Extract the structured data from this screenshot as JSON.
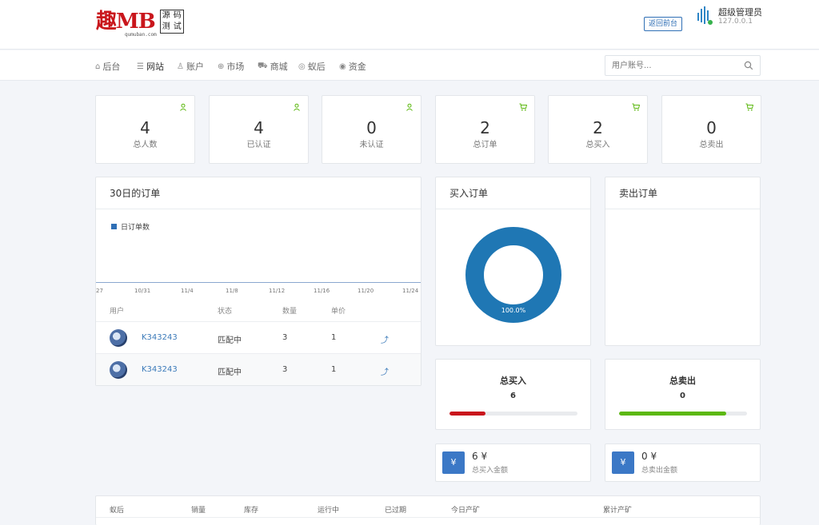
{
  "header": {
    "logo_main": "趣MB",
    "logo_sub": "qumuban.com",
    "logo_box": [
      "源",
      "码",
      "测",
      "试"
    ],
    "back_label": "返回前台",
    "admin_name": "超级管理员",
    "admin_ip": "127.0.0.1",
    "colors": {
      "logo": "#c9161c",
      "accent": "#2f6fb5",
      "online": "#37b24d"
    }
  },
  "nav": {
    "items": [
      {
        "label": "后台",
        "icon": "home-icon"
      },
      {
        "label": "网站",
        "icon": "list-icon"
      },
      {
        "label": "账户",
        "icon": "users-icon"
      },
      {
        "label": "市场",
        "icon": "globe-icon"
      },
      {
        "label": "商城",
        "icon": "cart-icon"
      },
      {
        "label": "蚁后",
        "icon": "circle-icon"
      },
      {
        "label": "资金",
        "icon": "coin-icon"
      }
    ],
    "search_placeholder": "用户账号..."
  },
  "stats": [
    {
      "value": "4",
      "label": "总人数",
      "icon": "user-icon"
    },
    {
      "value": "4",
      "label": "已认证",
      "icon": "user-icon"
    },
    {
      "value": "0",
      "label": "未认证",
      "icon": "user-icon"
    },
    {
      "value": "2",
      "label": "总订单",
      "icon": "cart-icon"
    },
    {
      "value": "2",
      "label": "总买入",
      "icon": "cart-icon"
    },
    {
      "value": "0",
      "label": "总卖出",
      "icon": "cart-icon"
    }
  ],
  "orders_panel": {
    "title": "30日的订单",
    "legend": "日订单数",
    "chart_data": {
      "type": "line",
      "x": [
        "27",
        "10/31",
        "11/4",
        "11/8",
        "11/12",
        "11/16",
        "11/20",
        "11/24"
      ],
      "series": [
        {
          "name": "日订单数",
          "values": [
            0,
            0,
            0,
            0,
            0,
            0,
            0,
            0
          ]
        }
      ]
    },
    "table_headers": [
      "用户",
      "状态",
      "数量",
      "单价"
    ],
    "rows": [
      {
        "user": "K343243",
        "status": "匹配中",
        "qty": "3",
        "price": "1"
      },
      {
        "user": "K343243",
        "status": "匹配中",
        "qty": "3",
        "price": "1"
      }
    ]
  },
  "buy_panel": {
    "title": "买入订单",
    "chart_data": {
      "type": "pie",
      "slices": [
        {
          "label": "100.0%",
          "value": 100
        }
      ],
      "color": "#1f77b4"
    },
    "label": "100.0%"
  },
  "sell_panel": {
    "title": "卖出订单"
  },
  "total_buy": {
    "title": "总买入",
    "value": "6",
    "progress": 0.28,
    "color": "#c9161c"
  },
  "total_sell": {
    "title": "总卖出",
    "value": "0",
    "progress": 0.84,
    "color": "#5cb811"
  },
  "buy_amount": {
    "value": "6 ¥",
    "label": "总买入金额",
    "icon": "yen-icon"
  },
  "sell_amount": {
    "value": "0 ¥",
    "label": "总卖出金额",
    "icon": "yen-icon"
  },
  "bottom_table": {
    "headers": [
      "蚁后",
      "销量",
      "库存",
      "运行中",
      "已过期",
      "今日产矿",
      "累计产矿"
    ]
  }
}
